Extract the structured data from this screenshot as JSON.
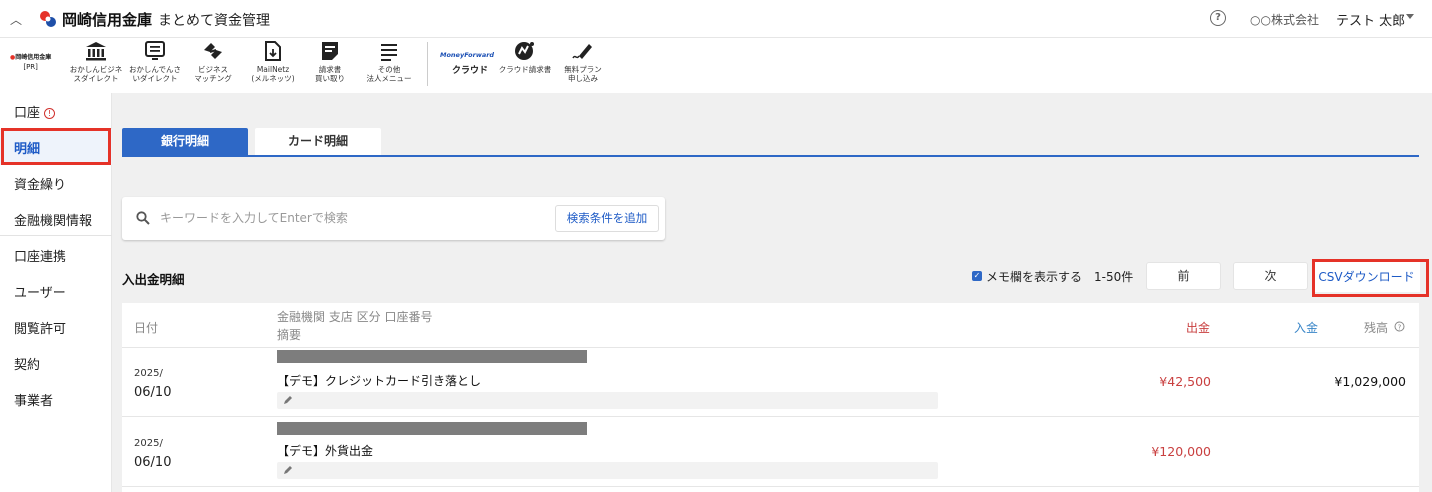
{
  "header": {
    "brand_name": "岡崎信用金庫",
    "product_name": "まとめて資金管理",
    "help_label": "?",
    "company": "○○株式会社",
    "user": "テスト 太郎"
  },
  "toolbar": {
    "pr_logo": "岡崎信用金庫",
    "pr_tag": "[PR]",
    "tools": [
      {
        "icon": "bank-icon",
        "label": "おかしんビジネ\nスダイレクト"
      },
      {
        "icon": "monitor-list-icon",
        "label": "おかしんでんさ\nいダイレクト"
      },
      {
        "icon": "handshake-icon",
        "label": "ビジネス\nマッチング"
      },
      {
        "icon": "file-download-icon",
        "label": "MailNetz\n(メルネッツ)"
      },
      {
        "icon": "invoice-icon",
        "label": "請求書\n買い取り"
      },
      {
        "icon": "menu-lines-icon",
        "label": "その他\n法人メニュー"
      }
    ],
    "mf_logo": "MoneyForward",
    "mf_cloud": "クラウド",
    "mf_tools": [
      {
        "icon": "mf-invoice-icon",
        "label": "クラウド請求書"
      },
      {
        "icon": "pen-signature-icon",
        "label": "無料プラン\n申し込み"
      }
    ]
  },
  "sidebar": {
    "items": [
      {
        "label": "口座"
      },
      {
        "label": "明細"
      },
      {
        "label": "資金繰り"
      },
      {
        "label": "金融機関情報"
      },
      {
        "label": "口座連携"
      },
      {
        "label": "ユーザー"
      },
      {
        "label": "閲覧許可"
      },
      {
        "label": "契約"
      },
      {
        "label": "事業者"
      }
    ],
    "alert_glyph": "!"
  },
  "tabs": {
    "bank": "銀行明細",
    "card": "カード明細"
  },
  "search": {
    "placeholder": "キーワードを入力してEnterで検索",
    "add_condition": "検索条件を追加"
  },
  "list": {
    "title": "入出金明細",
    "memo_toggle": "メモ欄を表示する",
    "range": "1-50件",
    "prev": "前",
    "next": "次",
    "csv": "CSVダウンロード"
  },
  "table": {
    "headers": {
      "date": "日付",
      "account": "金融機関 支店 区分 口座番号",
      "summary": "摘要",
      "out": "出金",
      "in": "入金",
      "balance": "残高"
    },
    "rows": [
      {
        "year": "2025/",
        "day": "06/10",
        "summary": "【デモ】クレジットカード引き落とし",
        "out": "¥42,500",
        "in": "",
        "balance": "¥1,029,000"
      },
      {
        "year": "2025/",
        "day": "06/10",
        "summary": "【デモ】外貨出金",
        "out": "¥120,000",
        "in": "",
        "balance": ""
      }
    ]
  },
  "colors": {
    "accent": "#2e68c6",
    "highlight": "#e53228",
    "outflow": "#c94040",
    "inflow": "#3a86c8"
  }
}
